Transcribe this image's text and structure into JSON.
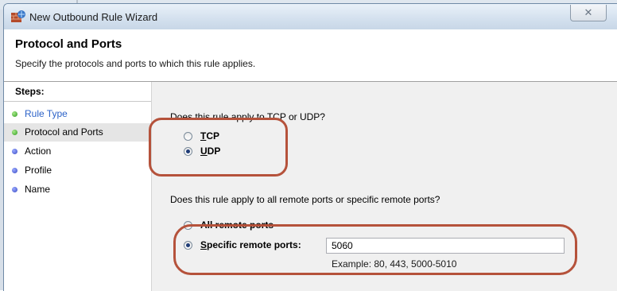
{
  "window": {
    "title": "New Outbound Rule Wizard",
    "close_glyph": "✕"
  },
  "header": {
    "title": "Protocol and Ports",
    "description": "Specify the protocols and ports to which this rule applies."
  },
  "sidebar": {
    "heading": "Steps:",
    "items": [
      {
        "label": "Rule Type",
        "status": "complete",
        "style": "link"
      },
      {
        "label": "Protocol and Ports",
        "status": "current",
        "style": "active"
      },
      {
        "label": "Action",
        "status": "pending"
      },
      {
        "label": "Profile",
        "status": "pending"
      },
      {
        "label": "Name",
        "status": "pending"
      }
    ]
  },
  "protocol": {
    "question": "Does this rule apply to TCP or UDP?",
    "options": [
      {
        "key": "T",
        "rest": "CP",
        "checked": false
      },
      {
        "key": "U",
        "rest": "DP",
        "checked": true
      }
    ]
  },
  "ports": {
    "question": "Does this rule apply to all remote ports or specific remote ports?",
    "all_label": "All remote ports",
    "specific_key": "S",
    "specific_rest": "pecific remote ports:",
    "value": "5060",
    "example": "Example: 80, 443, 5000-5010"
  },
  "colors": {
    "annotation": "#b5523b",
    "link": "#2d63c8",
    "complete_dot": "#2f9a1f",
    "pending_dot": "#3a4cc4"
  }
}
